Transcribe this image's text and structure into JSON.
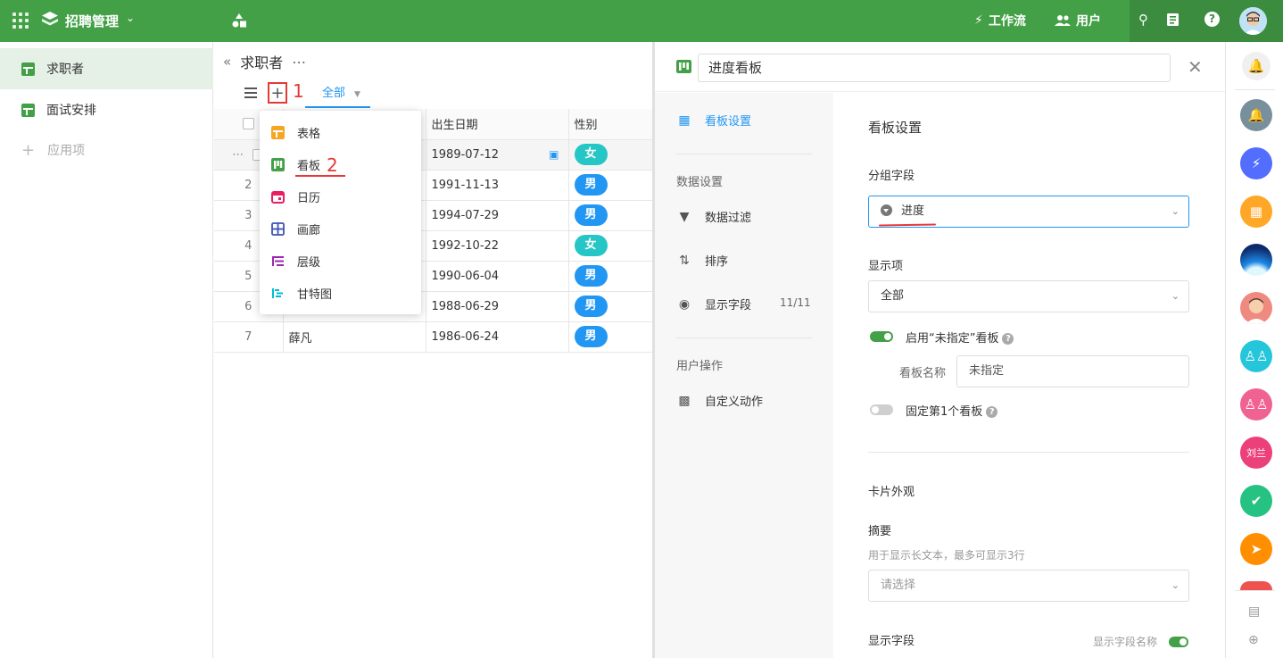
{
  "topbar": {
    "app_title": "招聘管理",
    "workflow_label": "工作流",
    "users_label": "用户"
  },
  "sidebar": {
    "items": [
      {
        "label": "求职者"
      },
      {
        "label": "面试安排"
      }
    ],
    "add_label": "应用项"
  },
  "sheet": {
    "title": "求职者",
    "view_tab": "全部",
    "columns": [
      "出生日期",
      "性别"
    ],
    "rows": [
      {
        "idx": "",
        "name": "",
        "date": "1989-07-12",
        "sex": "女"
      },
      {
        "idx": "2",
        "name": "",
        "date": "1991-11-13",
        "sex": "男"
      },
      {
        "idx": "3",
        "name": "",
        "date": "1994-07-29",
        "sex": "男"
      },
      {
        "idx": "4",
        "name": "",
        "date": "1992-10-22",
        "sex": "女"
      },
      {
        "idx": "5",
        "name": "",
        "date": "1990-06-04",
        "sex": "男"
      },
      {
        "idx": "6",
        "name": "",
        "date": "1988-06-29",
        "sex": "男"
      },
      {
        "idx": "7",
        "name": "薛凡",
        "date": "1986-06-24",
        "sex": "男"
      }
    ]
  },
  "annotations": {
    "one": "1",
    "two": "2"
  },
  "view_menu": {
    "items": [
      {
        "label": "表格",
        "color": "#f5a623"
      },
      {
        "label": "看板",
        "color": "#43a047"
      },
      {
        "label": "日历",
        "color": "#e91e63"
      },
      {
        "label": "画廊",
        "color": "#3f51b5"
      },
      {
        "label": "层级",
        "color": "#9c27b0"
      },
      {
        "label": "甘特图",
        "color": "#00bcd4"
      }
    ]
  },
  "drawer": {
    "title_value": "进度看板",
    "nav": {
      "kanban_settings": "看板设置",
      "data_section": "数据设置",
      "filter": "数据过滤",
      "sort": "排序",
      "display_fields": "显示字段",
      "display_count": "11/11",
      "user_section": "用户操作",
      "custom_action": "自定义动作"
    },
    "body": {
      "heading": "看板设置",
      "group_field_label": "分组字段",
      "group_field_value": "进度",
      "display_items_label": "显示项",
      "display_items_value": "全部",
      "enable_unassigned": "启用“未指定”看板",
      "board_name_label": "看板名称",
      "board_name_value": "未指定",
      "pin_first": "固定第1个看板",
      "card_section": "卡片外观",
      "summary_label": "摘要",
      "summary_hint": "用于显示长文本，最多可显示3行",
      "summary_placeholder": "请选择",
      "display_fields_label": "显示字段",
      "show_field_names": "显示字段名称"
    }
  },
  "rail": {
    "user_initials": "刘兰"
  },
  "colors": {
    "brand": "#43a047",
    "accent": "#2196f3",
    "annotation": "#e53935"
  }
}
